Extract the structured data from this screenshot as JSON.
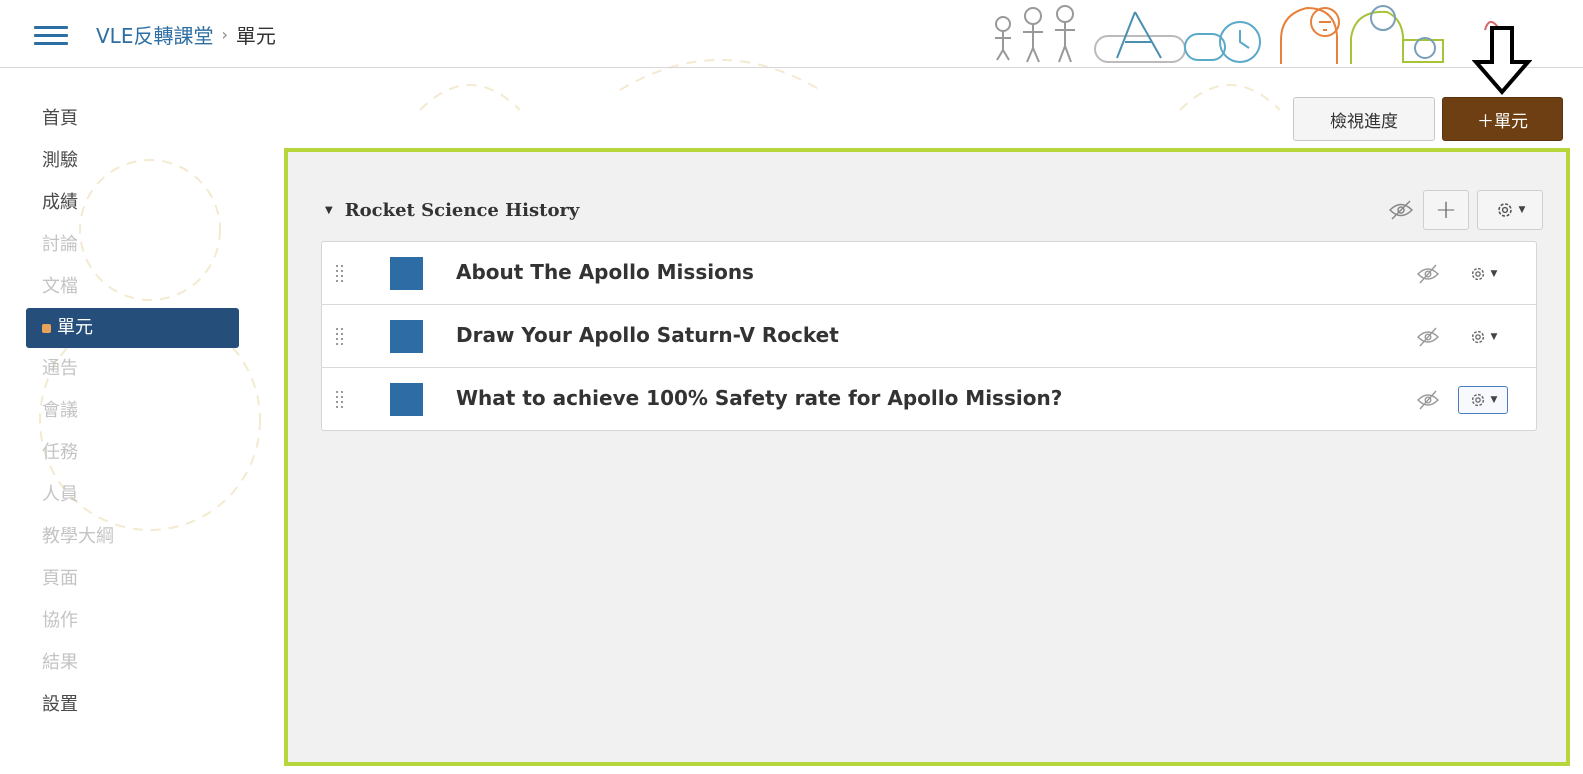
{
  "header": {
    "breadcrumb_course": "VLE反轉課堂",
    "breadcrumb_separator": "›",
    "breadcrumb_current": "單元"
  },
  "sidebar": {
    "items": [
      {
        "label": "首頁",
        "state": "enabled"
      },
      {
        "label": "測驗",
        "state": "enabled"
      },
      {
        "label": "成績",
        "state": "enabled"
      },
      {
        "label": "討論",
        "state": "disabled"
      },
      {
        "label": "文檔",
        "state": "disabled"
      },
      {
        "label": "單元",
        "state": "active"
      },
      {
        "label": "通告",
        "state": "disabled"
      },
      {
        "label": "會議",
        "state": "disabled"
      },
      {
        "label": "任務",
        "state": "disabled"
      },
      {
        "label": "人員",
        "state": "disabled"
      },
      {
        "label": "教學大綱",
        "state": "disabled"
      },
      {
        "label": "頁面",
        "state": "disabled"
      },
      {
        "label": "協作",
        "state": "disabled"
      },
      {
        "label": "結果",
        "state": "disabled"
      },
      {
        "label": "設置",
        "state": "enabled"
      }
    ]
  },
  "toolbar": {
    "view_progress_label": "檢視進度",
    "add_module_label": "＋單元"
  },
  "module": {
    "title": "Rocket Science History",
    "add_item_symbol": "+",
    "items": [
      {
        "title": "About The Apollo Missions"
      },
      {
        "title": "Draw Your Apollo Saturn-V Rocket"
      },
      {
        "title": "What to achieve 100% Safety rate for Apollo Mission?"
      }
    ]
  },
  "colors": {
    "accent_blue": "#254e7a",
    "add_module_brown": "#6e3f12",
    "highlight_green": "#b6d63c",
    "item_icon_blue": "#2e6ca5"
  },
  "icons": [
    "menu-icon",
    "eye-off-icon",
    "gear-icon",
    "drag-handle-icon",
    "arrow-down-icon"
  ]
}
